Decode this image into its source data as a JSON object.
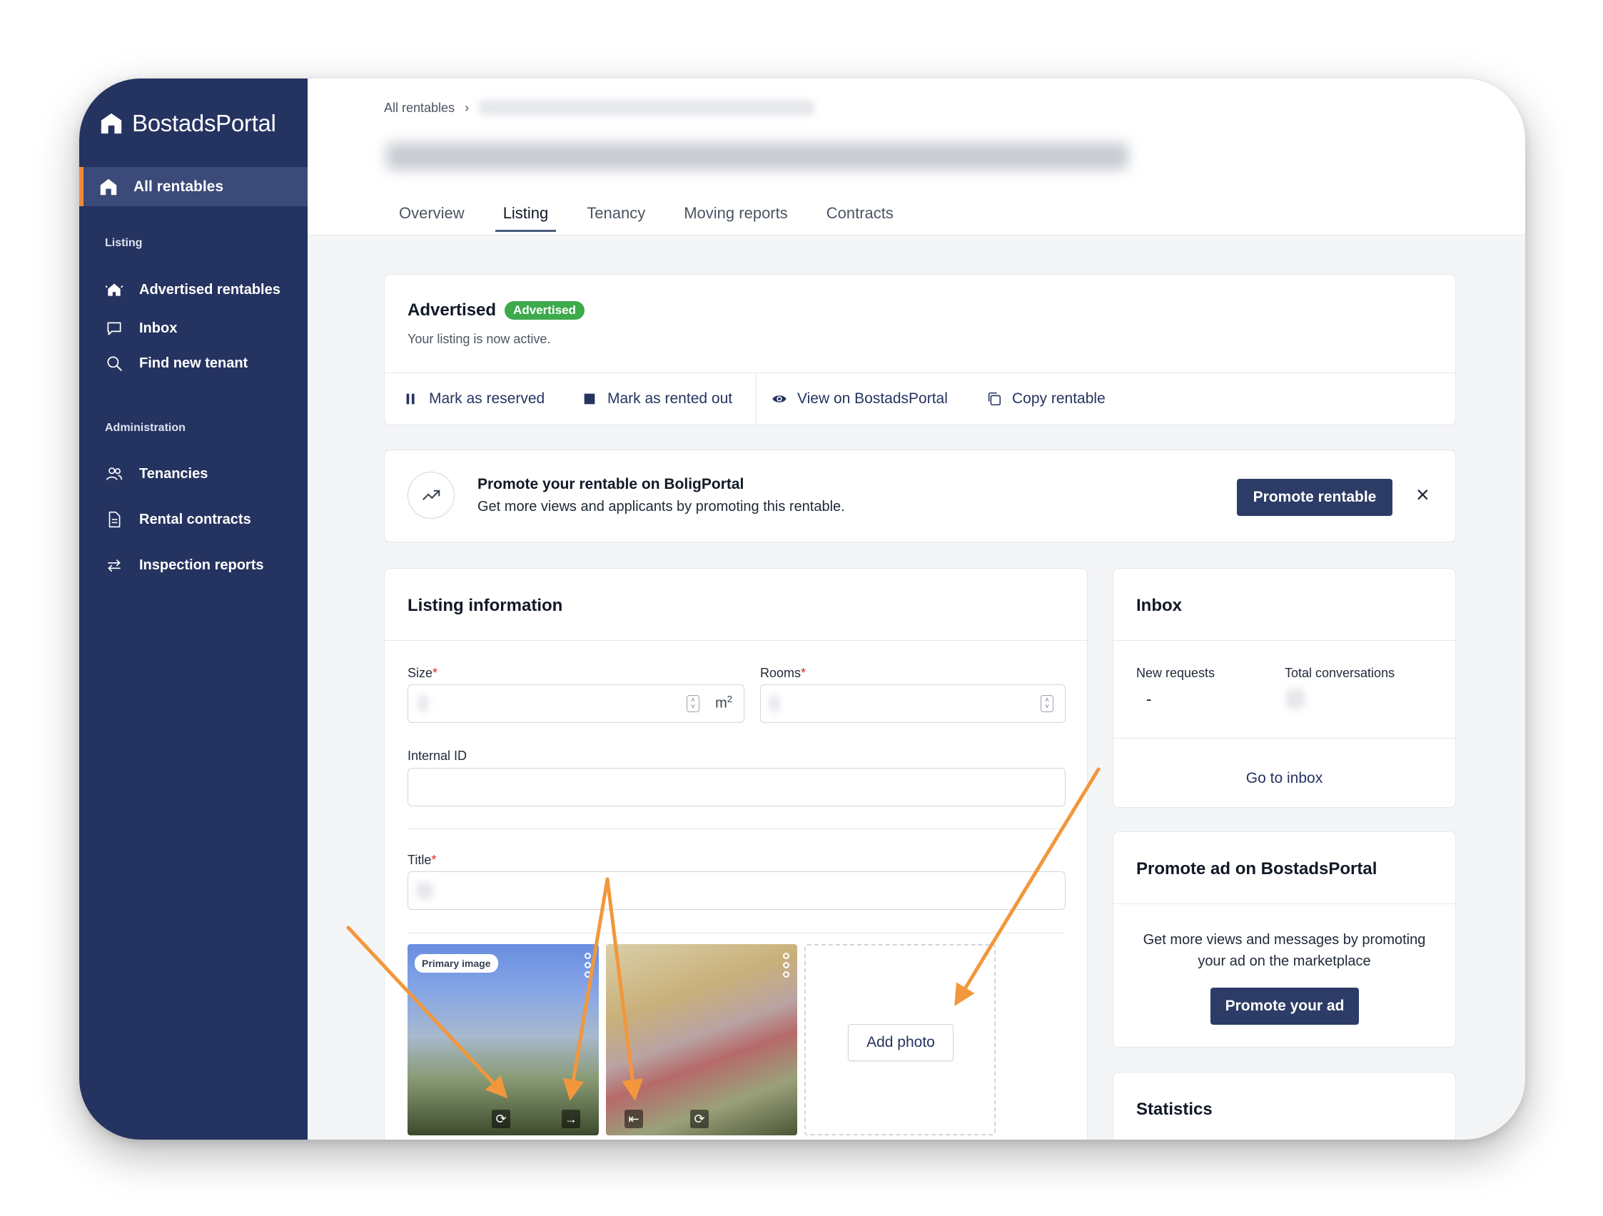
{
  "brand": {
    "name": "BostadsPortal"
  },
  "sidebar": {
    "active_item": "All rentables",
    "sections": [
      {
        "title": "Listing",
        "items": [
          "Advertised rentables",
          "Inbox",
          "Find new tenant"
        ]
      },
      {
        "title": "Administration",
        "items": [
          "Tenancies",
          "Rental contracts",
          "Inspection reports"
        ]
      }
    ]
  },
  "header": {
    "breadcrumb_root": "All rentables",
    "breadcrumb_sep": "›",
    "tabs": [
      "Overview",
      "Listing",
      "Tenancy",
      "Moving reports",
      "Contracts"
    ],
    "active_tab": "Listing"
  },
  "status_card": {
    "title": "Advertised",
    "badge": "Advertised",
    "subtitle": "Your listing is now active.",
    "actions": [
      "Mark as reserved",
      "Mark as rented out",
      "View on BostadsPortal",
      "Copy rentable"
    ]
  },
  "promo_banner": {
    "title": "Promote your rentable on BoligPortal",
    "text": "Get more views and applicants by promoting this rentable.",
    "button": "Promote rentable",
    "close": "×"
  },
  "listing_info": {
    "title": "Listing information",
    "size_label": "Size",
    "size_unit": "m",
    "size_unit_sup": "2",
    "rooms_label": "Rooms",
    "internal_id_label": "Internal ID",
    "title_label": "Title",
    "required_mark": "*",
    "primary_image_badge": "Primary image",
    "add_photo": "Add photo"
  },
  "inbox": {
    "title": "Inbox",
    "new_requests_label": "New requests",
    "new_requests_value": "-",
    "total_conversations_label": "Total conversations",
    "link": "Go to inbox"
  },
  "promote_ad": {
    "title": "Promote ad on BostadsPortal",
    "text": "Get more views and messages by promoting your ad on the marketplace",
    "button": "Promote your ad"
  },
  "statistics": {
    "title": "Statistics"
  },
  "colors": {
    "sidebar_bg": "#253360",
    "accent": "#f08a3c",
    "badge_green": "#3daa4c",
    "primary_button": "#2c3c66",
    "annotation_arrow": "#f2973c"
  }
}
